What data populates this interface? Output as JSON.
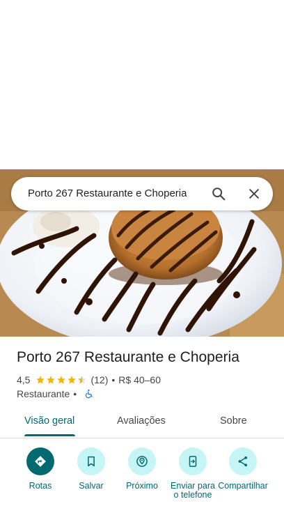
{
  "search": {
    "query": "Porto 267 Restaurante e Choperia"
  },
  "place": {
    "name": "Porto 267 Restaurante e Choperia",
    "rating": "4,5",
    "stars": 4.5,
    "reviews": "(12)",
    "price": "R$ 40–60",
    "category": "Restaurante",
    "dot": "•"
  },
  "tabs": [
    {
      "label": "Visão geral",
      "active": true
    },
    {
      "label": "Avaliações",
      "active": false
    },
    {
      "label": "Sobre",
      "active": false
    }
  ],
  "actions": [
    {
      "label": "Rotas",
      "icon": "directions-icon"
    },
    {
      "label": "Salvar",
      "icon": "bookmark-icon"
    },
    {
      "label": "Próximo",
      "icon": "nearby-icon"
    },
    {
      "label": "Enviar para o telefone",
      "icon": "send-to-phone-icon"
    },
    {
      "label": "Compartilhar",
      "icon": "share-icon"
    }
  ],
  "colors": {
    "accent": "#006a70",
    "action_bg": "#c5f5f5",
    "star": "#f4b400"
  }
}
